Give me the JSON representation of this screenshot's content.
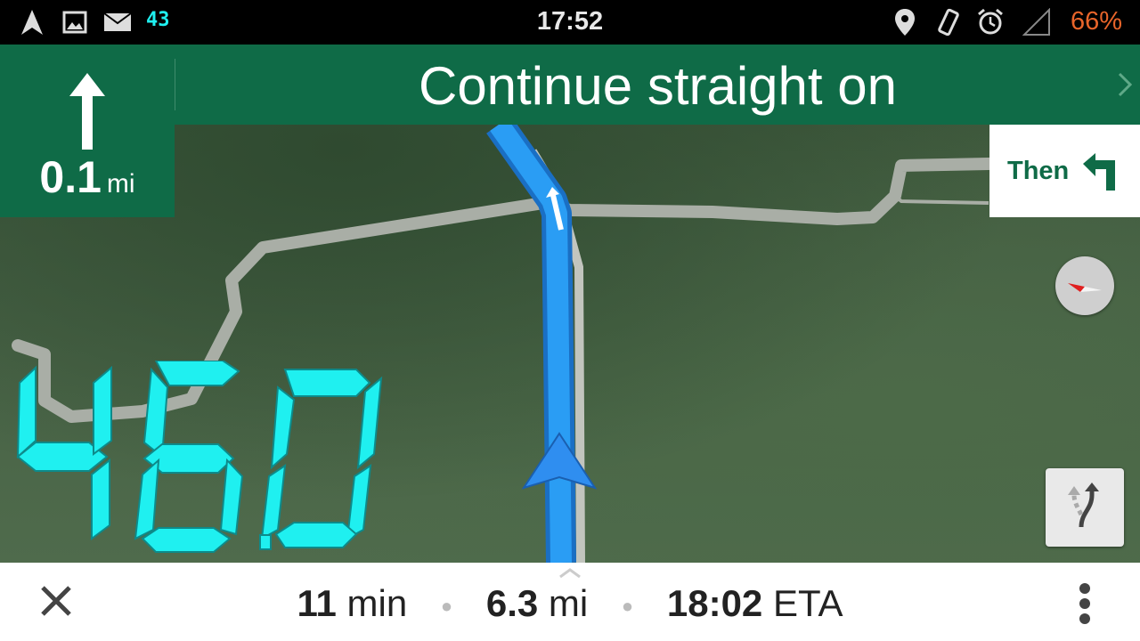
{
  "status_bar": {
    "time": "17:52",
    "battery": "66%",
    "notification_badge": "43",
    "icons": [
      "navigation-icon",
      "image-icon",
      "mail-icon",
      "speed-app-icon",
      "location-pin-icon",
      "vibrate-icon",
      "alarm-icon",
      "signal-icon"
    ]
  },
  "banner": {
    "maneuver_icon": "straight-arrow-icon",
    "distance_value": "0.1",
    "distance_unit": "mi",
    "instruction": "Continue straight on",
    "next_label": "Then",
    "next_icon": "turn-left-icon"
  },
  "speedometer": {
    "value": "46.0",
    "color": "#1ff0f0"
  },
  "trip": {
    "duration_value": "11",
    "duration_unit": "min",
    "distance_value": "6.3",
    "distance_unit": "mi",
    "eta_value": "18:02",
    "eta_unit": "ETA"
  },
  "colors": {
    "banner": "#0f6b47",
    "route": "#2a9df4",
    "battery": "#e8652a"
  }
}
